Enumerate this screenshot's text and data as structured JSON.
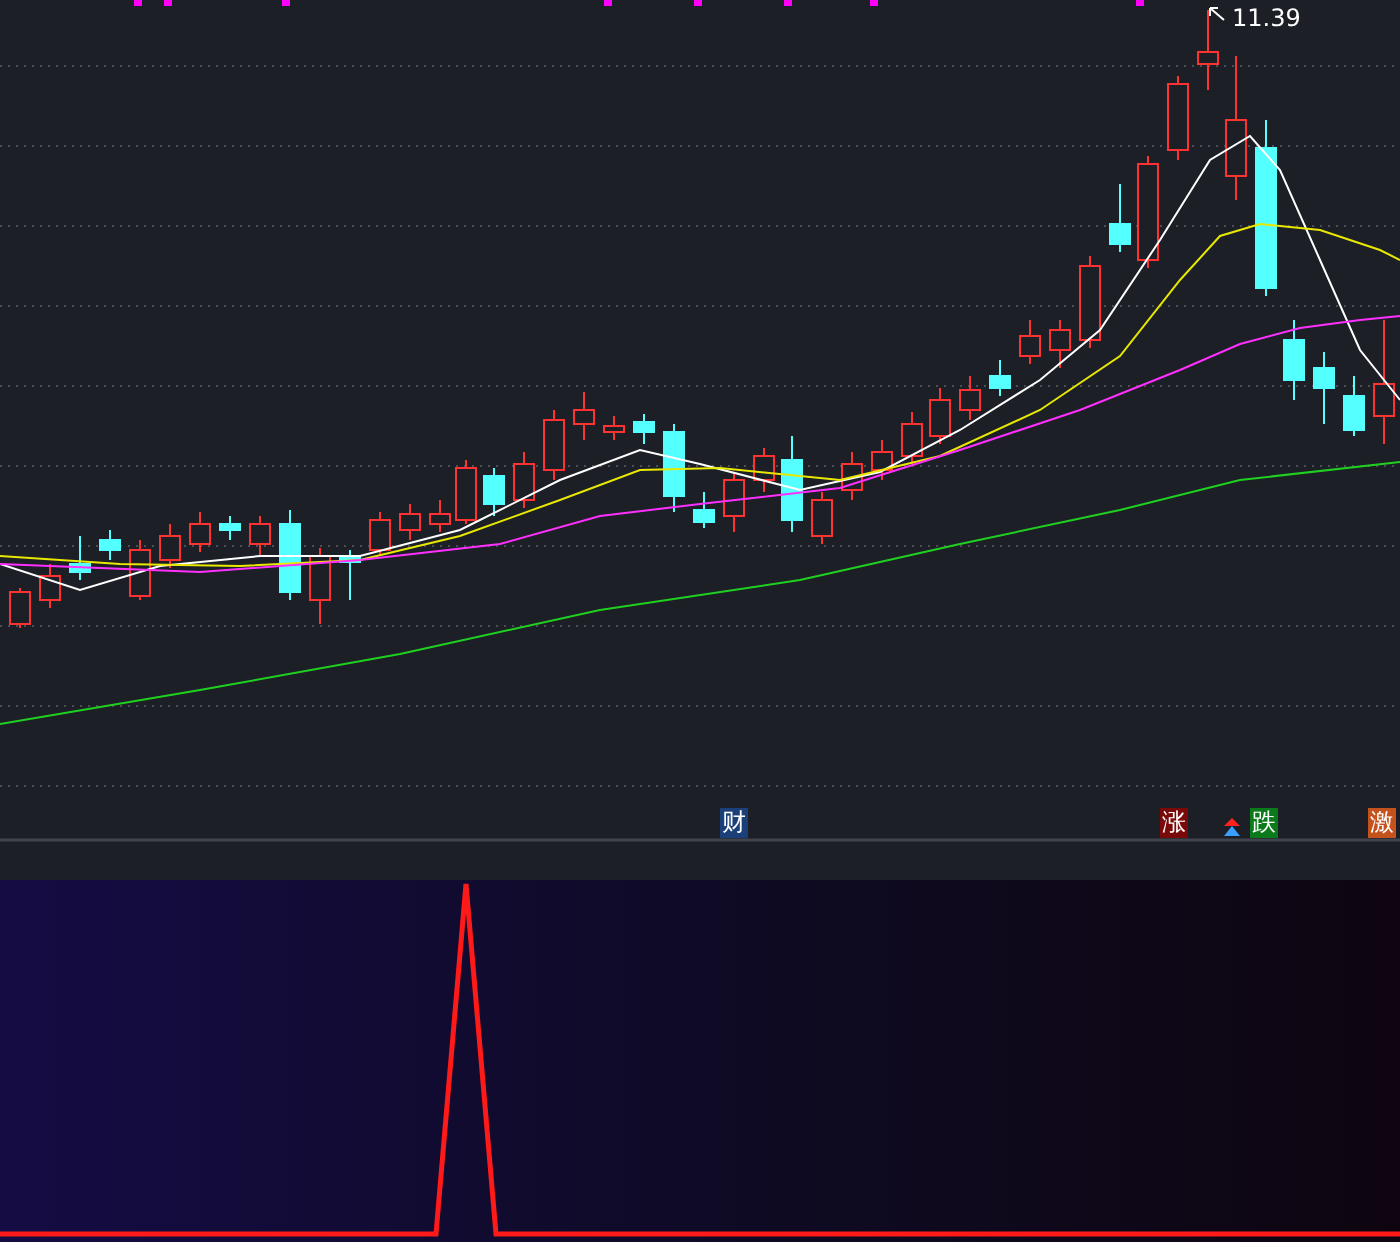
{
  "price_chart": {
    "high_label": "11.39",
    "markers": [
      {
        "text": "财",
        "color": "#1b3f78"
      },
      {
        "text": "涨",
        "color": "#7a0a0a"
      },
      {
        "text": "跌",
        "color": "#0a7a1a"
      },
      {
        "text": "激",
        "color": "#c4521c"
      }
    ]
  }
}
